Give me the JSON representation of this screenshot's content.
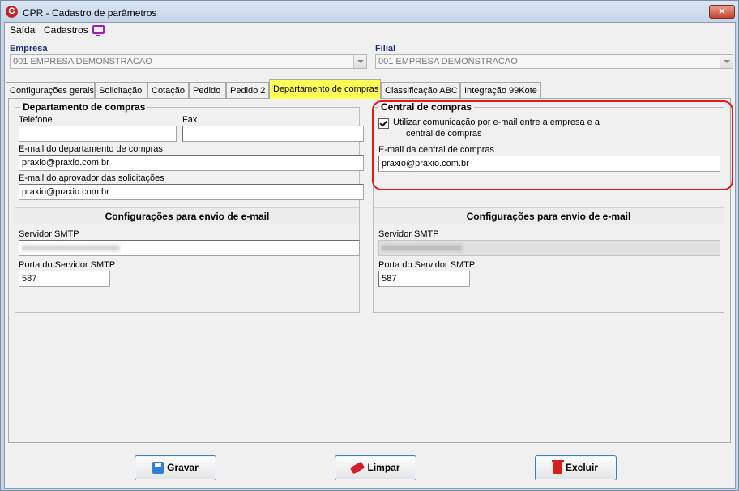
{
  "window": {
    "title": "CPR - Cadastro de parâmetros",
    "icon": "G",
    "close_glyph": "✕"
  },
  "menu": {
    "saida": "Saída",
    "cadastros": "Cadastros"
  },
  "empresa": {
    "label": "Empresa",
    "value": "001 EMPRESA DEMONSTRACAO"
  },
  "filial": {
    "label": "Filial",
    "value": "001 EMPRESA DEMONSTRACAO"
  },
  "tabs": [
    {
      "label": "Configurações gerais"
    },
    {
      "label": "Solicitação"
    },
    {
      "label": "Cotação"
    },
    {
      "label": "Pedido"
    },
    {
      "label": "Pedido 2"
    },
    {
      "label": "Departamento de compras"
    },
    {
      "label": "Classificação ABC"
    },
    {
      "label": "Integração 99Kote"
    }
  ],
  "left": {
    "title": "Departamento de compras",
    "telefone_label": "Telefone",
    "telefone_value": "",
    "fax_label": "Fax",
    "fax_value": "",
    "email_dep_label": "E-mail do departamento de compras",
    "email_dep_value": "praxio@praxio.com.br",
    "email_aprov_label": "E-mail do aprovador das solicitações",
    "email_aprov_value": "praxio@praxio.com.br",
    "smtp_header": "Configurações para envio de e-mail",
    "smtp_server_label": "Servidor SMTP",
    "smtp_server_value": "xxxxxxxxxxxxxxxxxxxxxx",
    "smtp_port_label": "Porta do Servidor SMTP",
    "smtp_port_value": "587"
  },
  "right": {
    "title": "Central de compras",
    "checkbox_line1": "Utilizar comunicação por e-mail entre a empresa e a",
    "checkbox_line2": "central de compras",
    "checkbox_checked": true,
    "email_central_label": "E-mail da central de compras",
    "email_central_value": "praxio@praxio.com.br",
    "smtp_header": "Configurações para envio de e-mail",
    "smtp_server_label": "Servidor SMTP",
    "smtp_server_value": "xxxxxxxxxxxxxxxxxx",
    "smtp_port_label": "Porta do Servidor SMTP",
    "smtp_port_value": "587"
  },
  "buttons": {
    "gravar": "Gravar",
    "limpar": "Limpar",
    "excluir": "Excluir"
  },
  "colors": {
    "active_tab": "#ffff55",
    "highlight": "#e01a1a",
    "label_blue": "#1a2e7a"
  }
}
